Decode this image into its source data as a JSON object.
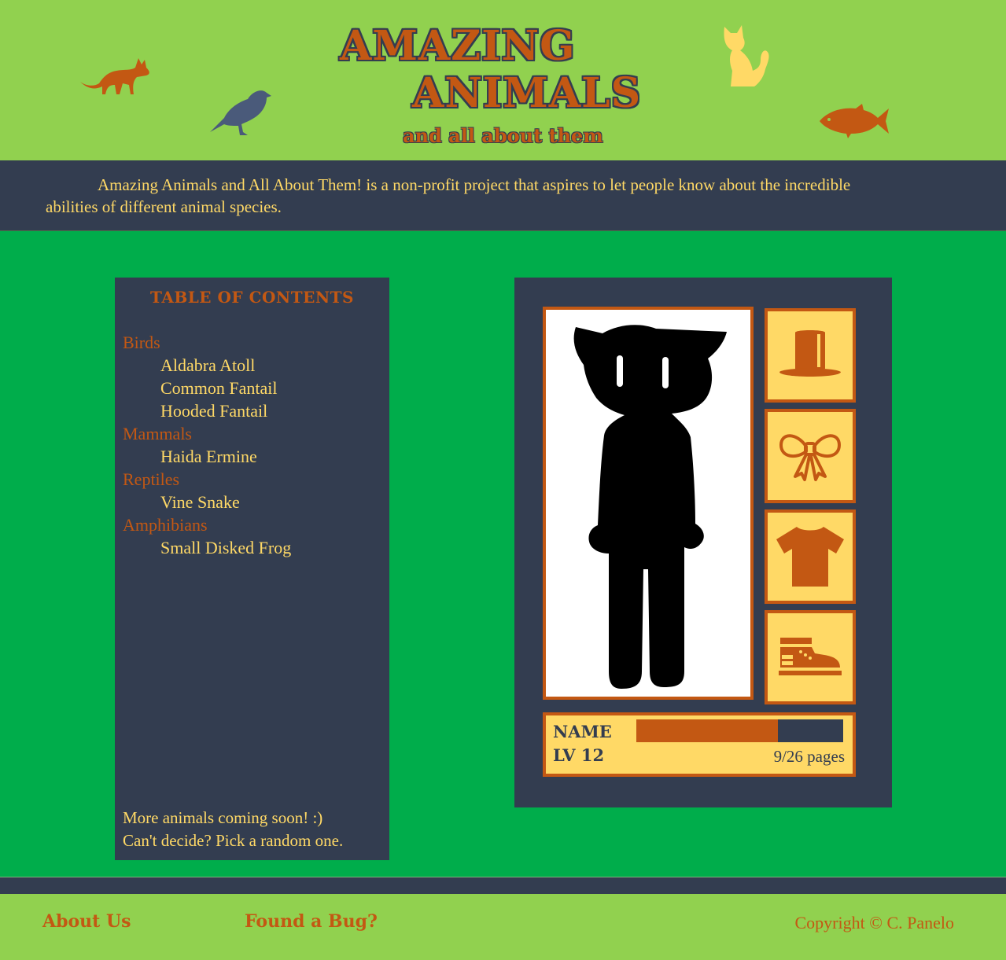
{
  "header": {
    "title_line1": "AMAZING",
    "title_line2": "ANIMALS",
    "subtitle": "and all about them",
    "decorations": [
      "fox-icon",
      "bird-icon",
      "cat-icon",
      "fish-icon"
    ]
  },
  "intro": {
    "text": "Amazing Animals and All About Them! is a non-profit project that aspires to let people know about the incredible abilities of different animal species."
  },
  "toc": {
    "title": "TABLE OF CONTENTS",
    "categories": [
      {
        "label": "Birds",
        "items": [
          "Aldabra Atoll",
          "Common Fantail",
          "Hooded Fantail"
        ]
      },
      {
        "label": "Mammals",
        "items": [
          "Haida Ermine"
        ]
      },
      {
        "label": "Reptiles",
        "items": [
          "Vine Snake"
        ]
      },
      {
        "label": "Amphibians",
        "items": [
          "Small Disked Frog"
        ]
      }
    ],
    "footer_line1": "More animals coming soon! :)",
    "footer_line2": "Can't decide? Pick a random one."
  },
  "game": {
    "slots": [
      "top-hat-icon",
      "bow-icon",
      "shirt-icon",
      "sneaker-icon"
    ],
    "stats": {
      "name_label": "NAME",
      "level_label": "LV 12",
      "progress_fraction": 0.6838,
      "pages_text": "9/26 pages"
    }
  },
  "footer": {
    "about_label": "About Us",
    "bug_label": "Found a Bug?",
    "copyright": "Copyright © C. Panelo"
  },
  "colors": {
    "header_bg": "#91d14f",
    "main_bg": "#00ad4b",
    "dark": "#333d50",
    "accent": "#c35813",
    "yellow": "#ffd966"
  }
}
